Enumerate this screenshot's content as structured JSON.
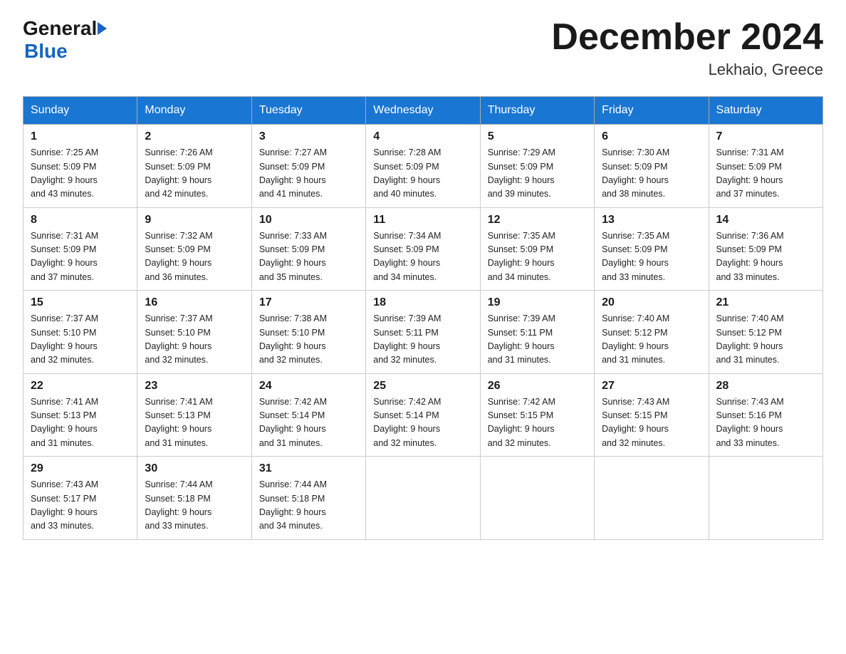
{
  "header": {
    "logo_general": "General",
    "logo_blue": "Blue",
    "month_title": "December 2024",
    "location": "Lekhaio, Greece"
  },
  "days_of_week": [
    "Sunday",
    "Monday",
    "Tuesday",
    "Wednesday",
    "Thursday",
    "Friday",
    "Saturday"
  ],
  "weeks": [
    [
      {
        "day": "1",
        "sunrise": "Sunrise: 7:25 AM",
        "sunset": "Sunset: 5:09 PM",
        "daylight": "Daylight: 9 hours",
        "minutes": "and 43 minutes."
      },
      {
        "day": "2",
        "sunrise": "Sunrise: 7:26 AM",
        "sunset": "Sunset: 5:09 PM",
        "daylight": "Daylight: 9 hours",
        "minutes": "and 42 minutes."
      },
      {
        "day": "3",
        "sunrise": "Sunrise: 7:27 AM",
        "sunset": "Sunset: 5:09 PM",
        "daylight": "Daylight: 9 hours",
        "minutes": "and 41 minutes."
      },
      {
        "day": "4",
        "sunrise": "Sunrise: 7:28 AM",
        "sunset": "Sunset: 5:09 PM",
        "daylight": "Daylight: 9 hours",
        "minutes": "and 40 minutes."
      },
      {
        "day": "5",
        "sunrise": "Sunrise: 7:29 AM",
        "sunset": "Sunset: 5:09 PM",
        "daylight": "Daylight: 9 hours",
        "minutes": "and 39 minutes."
      },
      {
        "day": "6",
        "sunrise": "Sunrise: 7:30 AM",
        "sunset": "Sunset: 5:09 PM",
        "daylight": "Daylight: 9 hours",
        "minutes": "and 38 minutes."
      },
      {
        "day": "7",
        "sunrise": "Sunrise: 7:31 AM",
        "sunset": "Sunset: 5:09 PM",
        "daylight": "Daylight: 9 hours",
        "minutes": "and 37 minutes."
      }
    ],
    [
      {
        "day": "8",
        "sunrise": "Sunrise: 7:31 AM",
        "sunset": "Sunset: 5:09 PM",
        "daylight": "Daylight: 9 hours",
        "minutes": "and 37 minutes."
      },
      {
        "day": "9",
        "sunrise": "Sunrise: 7:32 AM",
        "sunset": "Sunset: 5:09 PM",
        "daylight": "Daylight: 9 hours",
        "minutes": "and 36 minutes."
      },
      {
        "day": "10",
        "sunrise": "Sunrise: 7:33 AM",
        "sunset": "Sunset: 5:09 PM",
        "daylight": "Daylight: 9 hours",
        "minutes": "and 35 minutes."
      },
      {
        "day": "11",
        "sunrise": "Sunrise: 7:34 AM",
        "sunset": "Sunset: 5:09 PM",
        "daylight": "Daylight: 9 hours",
        "minutes": "and 34 minutes."
      },
      {
        "day": "12",
        "sunrise": "Sunrise: 7:35 AM",
        "sunset": "Sunset: 5:09 PM",
        "daylight": "Daylight: 9 hours",
        "minutes": "and 34 minutes."
      },
      {
        "day": "13",
        "sunrise": "Sunrise: 7:35 AM",
        "sunset": "Sunset: 5:09 PM",
        "daylight": "Daylight: 9 hours",
        "minutes": "and 33 minutes."
      },
      {
        "day": "14",
        "sunrise": "Sunrise: 7:36 AM",
        "sunset": "Sunset: 5:09 PM",
        "daylight": "Daylight: 9 hours",
        "minutes": "and 33 minutes."
      }
    ],
    [
      {
        "day": "15",
        "sunrise": "Sunrise: 7:37 AM",
        "sunset": "Sunset: 5:10 PM",
        "daylight": "Daylight: 9 hours",
        "minutes": "and 32 minutes."
      },
      {
        "day": "16",
        "sunrise": "Sunrise: 7:37 AM",
        "sunset": "Sunset: 5:10 PM",
        "daylight": "Daylight: 9 hours",
        "minutes": "and 32 minutes."
      },
      {
        "day": "17",
        "sunrise": "Sunrise: 7:38 AM",
        "sunset": "Sunset: 5:10 PM",
        "daylight": "Daylight: 9 hours",
        "minutes": "and 32 minutes."
      },
      {
        "day": "18",
        "sunrise": "Sunrise: 7:39 AM",
        "sunset": "Sunset: 5:11 PM",
        "daylight": "Daylight: 9 hours",
        "minutes": "and 32 minutes."
      },
      {
        "day": "19",
        "sunrise": "Sunrise: 7:39 AM",
        "sunset": "Sunset: 5:11 PM",
        "daylight": "Daylight: 9 hours",
        "minutes": "and 31 minutes."
      },
      {
        "day": "20",
        "sunrise": "Sunrise: 7:40 AM",
        "sunset": "Sunset: 5:12 PM",
        "daylight": "Daylight: 9 hours",
        "minutes": "and 31 minutes."
      },
      {
        "day": "21",
        "sunrise": "Sunrise: 7:40 AM",
        "sunset": "Sunset: 5:12 PM",
        "daylight": "Daylight: 9 hours",
        "minutes": "and 31 minutes."
      }
    ],
    [
      {
        "day": "22",
        "sunrise": "Sunrise: 7:41 AM",
        "sunset": "Sunset: 5:13 PM",
        "daylight": "Daylight: 9 hours",
        "minutes": "and 31 minutes."
      },
      {
        "day": "23",
        "sunrise": "Sunrise: 7:41 AM",
        "sunset": "Sunset: 5:13 PM",
        "daylight": "Daylight: 9 hours",
        "minutes": "and 31 minutes."
      },
      {
        "day": "24",
        "sunrise": "Sunrise: 7:42 AM",
        "sunset": "Sunset: 5:14 PM",
        "daylight": "Daylight: 9 hours",
        "minutes": "and 31 minutes."
      },
      {
        "day": "25",
        "sunrise": "Sunrise: 7:42 AM",
        "sunset": "Sunset: 5:14 PM",
        "daylight": "Daylight: 9 hours",
        "minutes": "and 32 minutes."
      },
      {
        "day": "26",
        "sunrise": "Sunrise: 7:42 AM",
        "sunset": "Sunset: 5:15 PM",
        "daylight": "Daylight: 9 hours",
        "minutes": "and 32 minutes."
      },
      {
        "day": "27",
        "sunrise": "Sunrise: 7:43 AM",
        "sunset": "Sunset: 5:15 PM",
        "daylight": "Daylight: 9 hours",
        "minutes": "and 32 minutes."
      },
      {
        "day": "28",
        "sunrise": "Sunrise: 7:43 AM",
        "sunset": "Sunset: 5:16 PM",
        "daylight": "Daylight: 9 hours",
        "minutes": "and 33 minutes."
      }
    ],
    [
      {
        "day": "29",
        "sunrise": "Sunrise: 7:43 AM",
        "sunset": "Sunset: 5:17 PM",
        "daylight": "Daylight: 9 hours",
        "minutes": "and 33 minutes."
      },
      {
        "day": "30",
        "sunrise": "Sunrise: 7:44 AM",
        "sunset": "Sunset: 5:18 PM",
        "daylight": "Daylight: 9 hours",
        "minutes": "and 33 minutes."
      },
      {
        "day": "31",
        "sunrise": "Sunrise: 7:44 AM",
        "sunset": "Sunset: 5:18 PM",
        "daylight": "Daylight: 9 hours",
        "minutes": "and 34 minutes."
      },
      null,
      null,
      null,
      null
    ]
  ]
}
